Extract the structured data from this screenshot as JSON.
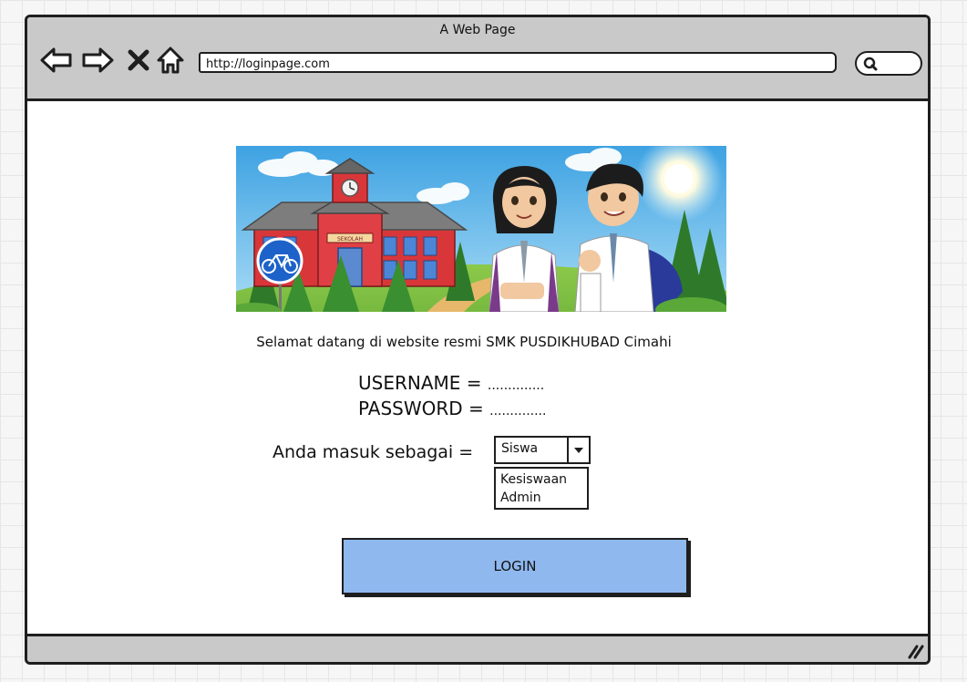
{
  "window": {
    "title": "A Web Page"
  },
  "toolbar": {
    "back_icon": "arrow-left-icon",
    "forward_icon": "arrow-right-icon",
    "stop_icon": "close-icon",
    "home_icon": "home-icon",
    "search_icon": "search-icon"
  },
  "address_bar": {
    "url": "http://loginpage.com"
  },
  "main": {
    "welcome_text": "Selamat datang di website resmi SMK PUSDIKHUBAD Cimahi",
    "hero_sign_text": "SEKOLAH",
    "username_label": "USERNAME =",
    "username_value": "..............",
    "password_label": "PASSWORD =",
    "password_value": "..............",
    "role_label": "Anda masuk sebagai =",
    "role_selected": "Siswa",
    "role_options": [
      "Kesiswaan",
      "Admin"
    ],
    "login_label": "LOGIN"
  },
  "colors": {
    "chrome": "#c9c9c9",
    "login_button": "#8fb8ee",
    "outline": "#1e1e1e",
    "sky": "#5fb6ea",
    "school_red": "#d9363a"
  }
}
